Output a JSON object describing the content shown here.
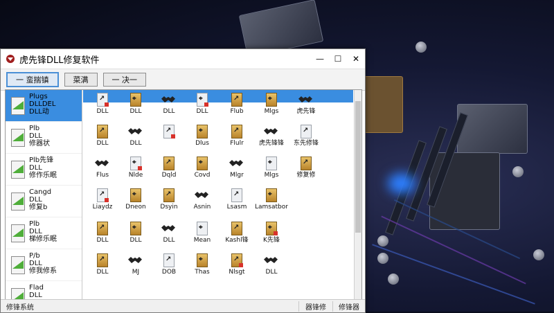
{
  "window": {
    "title": "虎先锋DLL修复软件",
    "minimize_glyph": "—",
    "maximize_glyph": "☐",
    "close_glyph": "✕"
  },
  "toolbar": {
    "buttons": [
      "一 蛮揣镇",
      "菜满",
      "一 决一"
    ]
  },
  "sidebar": {
    "items": [
      {
        "lines": [
          "Plugs",
          "DLLDEL",
          "DLL动"
        ]
      },
      {
        "lines": [
          "Plb",
          "DLL",
          "修器状"
        ]
      },
      {
        "lines": [
          "Plb先锋",
          "DLL",
          "修作乐眠"
        ]
      },
      {
        "lines": [
          "Cangd",
          "DLL",
          "修复b"
        ]
      },
      {
        "lines": [
          "Plb",
          "DLL",
          "梯修乐眠"
        ]
      },
      {
        "lines": [
          "P/b",
          "DLL",
          "修我修系"
        ]
      },
      {
        "lines": [
          "Flad",
          "DLL"
        ]
      }
    ]
  },
  "grid": {
    "rows": [
      [
        "DLL",
        "DLL",
        "DLL",
        "DLL",
        "Flub",
        "Mlgs",
        "虎先锋"
      ],
      [
        "DLL",
        "DLL",
        "",
        "Dlus",
        "Flulr",
        "虎先锋锋",
        "东先修锋"
      ],
      [
        "Flus",
        "Nlde",
        "Dqld",
        "Covd",
        "Mlgr",
        "Mlgs",
        "修复修"
      ],
      [
        "Liaydz",
        "Dneon",
        "Dsyin",
        "Asnin",
        "Lsasm",
        "Lamsatbor"
      ],
      [
        "DLL",
        "DLL",
        "DLL",
        "Mean",
        "Kashl锋",
        "K先锋"
      ],
      [
        "DLL",
        "MJ",
        "DOB",
        "Thas",
        "Nlsgt",
        "DLL"
      ]
    ]
  },
  "status": {
    "left": "修锋系统",
    "middle": "器锋修",
    "right": "修锋器"
  },
  "colors": {
    "selection": "#3a8de0",
    "window_bg": "#ffffff",
    "scene_bg": "#0a0d1c"
  }
}
